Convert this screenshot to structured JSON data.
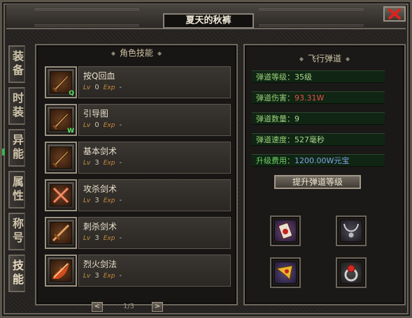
{
  "window": {
    "title": "夏天的秋裤"
  },
  "side_tabs": [
    {
      "label": "装备",
      "active": false
    },
    {
      "label": "时装",
      "active": false
    },
    {
      "label": "异能",
      "active": false
    },
    {
      "label": "属性",
      "active": false
    },
    {
      "label": "称号",
      "active": false
    },
    {
      "label": "技能",
      "active": true
    }
  ],
  "skills_panel": {
    "title": "角色技能",
    "skills": [
      {
        "name": "按Q回血",
        "hotkey": "Q",
        "lv_label": "Lv",
        "level": "0",
        "exp_label": "Exp",
        "exp": "-",
        "icon": "sword-icon"
      },
      {
        "name": "引导图",
        "hotkey": "W",
        "lv_label": "Lv",
        "level": "0",
        "exp_label": "Exp",
        "exp": "-",
        "icon": "sword-icon"
      },
      {
        "name": "基本剑术",
        "hotkey": "",
        "lv_label": "Lv",
        "level": "3",
        "exp_label": "Exp",
        "exp": "-",
        "icon": "sword-icon"
      },
      {
        "name": "攻杀剑术",
        "hotkey": "",
        "lv_label": "Lv",
        "level": "3",
        "exp_label": "Exp",
        "exp": "-",
        "icon": "crossed-swords-icon"
      },
      {
        "name": "刺杀剑术",
        "hotkey": "",
        "lv_label": "Lv",
        "level": "3",
        "exp_label": "Exp",
        "exp": "-",
        "icon": "thrust-sword-icon"
      },
      {
        "name": "烈火剑法",
        "hotkey": "",
        "lv_label": "Lv",
        "level": "3",
        "exp_label": "Exp",
        "exp": "-",
        "icon": "flame-sword-icon"
      }
    ],
    "pager": {
      "prev": "<",
      "next": ">",
      "page": "1/3"
    }
  },
  "flying_bullet_panel": {
    "title": "飞行弹道",
    "stats": [
      {
        "label": "弹道等级：",
        "value": "35级",
        "style": "normal"
      },
      {
        "label": "弹道伤害：",
        "value": "93.31W",
        "style": "red"
      },
      {
        "label": "弹道数量：",
        "value": "9",
        "style": "normal"
      },
      {
        "label": "弹道速度：",
        "value": "527毫秒",
        "style": "normal"
      },
      {
        "label": "升级费用：",
        "value": "1200.00W元宝",
        "style": "blue"
      }
    ],
    "upgrade_button": "提升弹道等级",
    "items": [
      "card-icon",
      "necklace-icon",
      "horn-icon",
      "ring-icon"
    ]
  },
  "colors": {
    "accent_green": "#9ad17b",
    "damage_red": "#e2504a",
    "fee_blue": "#7fa6e6"
  }
}
